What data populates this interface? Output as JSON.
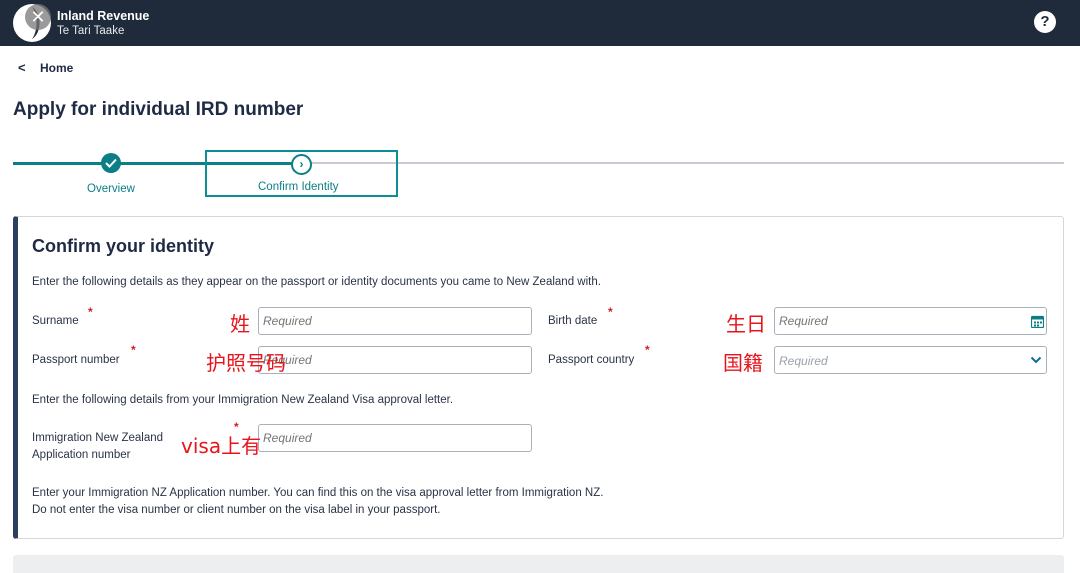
{
  "header": {
    "close_glyph": "✕",
    "brand_title": "Inland Revenue",
    "brand_subtitle": "Te Tari Taake",
    "help_glyph": "?",
    "colors": {
      "bar": "#1f2a3a"
    }
  },
  "breadcrumb": {
    "chevron": "<",
    "label": "Home"
  },
  "page": {
    "title": "Apply for individual IRD number"
  },
  "stepper": {
    "steps": [
      {
        "label": "Overview",
        "state": "complete"
      },
      {
        "label": "Confirm Identity",
        "state": "current",
        "glyph": "›"
      }
    ],
    "accent": "#0b7f86"
  },
  "card": {
    "title": "Confirm your identity",
    "intro": "Enter the following details as they appear on the passport or identity documents you came to New Zealand with.",
    "fields": {
      "surname": {
        "label": "Surname",
        "required_mark": "*",
        "placeholder": "Required",
        "annotation": "姓"
      },
      "birth_date": {
        "label": "Birth date",
        "required_mark": "*",
        "placeholder": "Required",
        "annotation": "生日",
        "icon": "calendar-icon"
      },
      "passport_number": {
        "label": "Passport number",
        "required_mark": "*",
        "placeholder": "Required",
        "annotation": "护照号码"
      },
      "passport_country": {
        "label": "Passport country",
        "required_mark": "*",
        "placeholder": "Required",
        "annotation": "国籍",
        "icon": "chevron-down-icon"
      },
      "immigration": {
        "label_line1": "Immigration New Zealand",
        "label_line2": "Application number",
        "required_mark": "*",
        "placeholder": "Required",
        "annotation": "visa上有"
      }
    },
    "visa_intro": "Enter the following details from your Immigration New Zealand Visa approval letter.",
    "help_line1": "Enter your Immigration NZ Application number. You can find this on the visa approval letter from Immigration NZ.",
    "help_line2": "Do not enter the visa number or client number on the visa label in your passport."
  }
}
